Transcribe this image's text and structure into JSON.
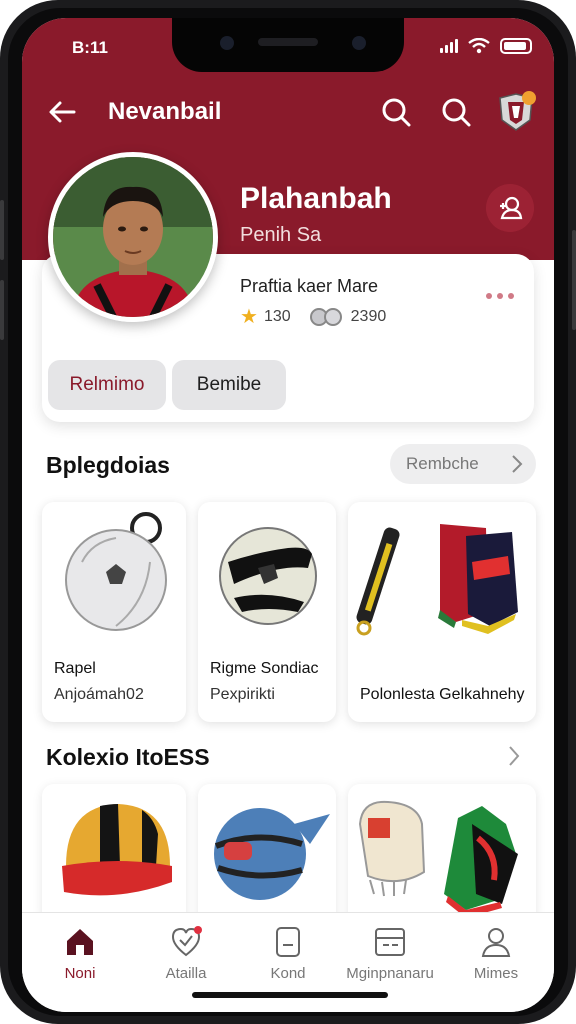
{
  "status_bar": {
    "time": "B:11"
  },
  "header": {
    "title": "Nevanbail"
  },
  "profile": {
    "name": "Plahanbah",
    "role": "Penih Sa",
    "club": "Praftia kaer Mare",
    "rating": "130",
    "points": "2390",
    "tabs": [
      {
        "label": "Relmimo",
        "active": true
      },
      {
        "label": "Bemibe",
        "active": false
      }
    ]
  },
  "section1": {
    "title": "Bplegdoias",
    "see_all": "Rembche",
    "items": [
      {
        "title": "Rapel",
        "subtitle": "Anjoámah02",
        "icon": "ball-keychain"
      },
      {
        "title": "Rigme Sondiac",
        "subtitle": "Pexpirikti",
        "icon": "soccer-ball"
      },
      {
        "title": "Polonlesta Gelkahnehy",
        "subtitle": "",
        "icon": "shin-guards"
      }
    ]
  },
  "section2": {
    "title": "Kolexio ItoESS",
    "items": [
      {
        "icon": "cap"
      },
      {
        "icon": "ball"
      },
      {
        "icon": "gloves"
      },
      {
        "icon": "boots"
      }
    ]
  },
  "bottom_nav": [
    {
      "label": "Noni",
      "icon": "home-icon",
      "active": true
    },
    {
      "label": "Atailla",
      "icon": "heart-icon",
      "active": false
    },
    {
      "label": "Kond",
      "icon": "card-icon",
      "active": false
    },
    {
      "label": "Mginpnanaru",
      "icon": "calendar-icon",
      "active": false
    },
    {
      "label": "Mimes",
      "icon": "person-icon",
      "active": false
    }
  ],
  "colors": {
    "brand": "#8a1a2b",
    "accent": "#b8273c",
    "background": "#ffffff"
  }
}
